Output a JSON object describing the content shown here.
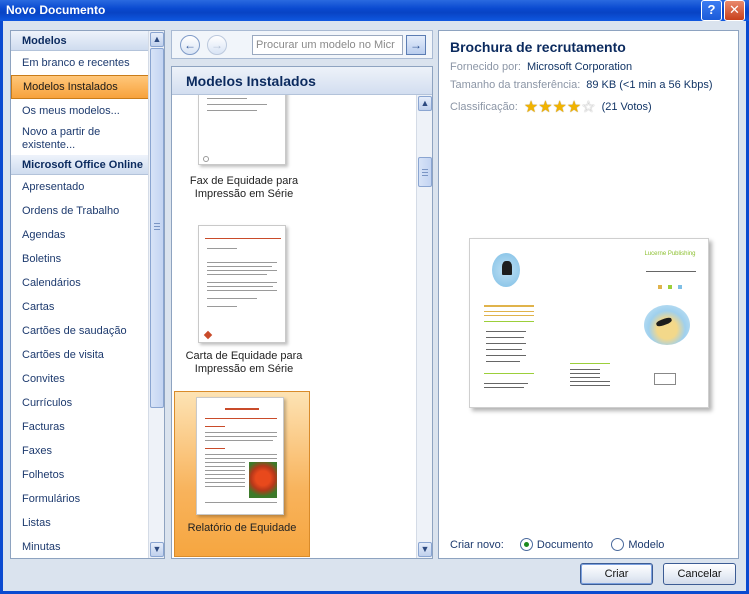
{
  "window": {
    "title": "Novo Documento",
    "help": "?",
    "close": "✕"
  },
  "left": {
    "sections": [
      {
        "header": "Modelos",
        "items": [
          {
            "label": "Em branco e recentes",
            "selected": false
          },
          {
            "label": "Modelos Instalados",
            "selected": true
          },
          {
            "label": "Os meus modelos...",
            "selected": false
          },
          {
            "label": "Novo a partir de existente...",
            "selected": false
          }
        ]
      },
      {
        "header": "Microsoft Office Online",
        "items": [
          {
            "label": "Apresentado"
          },
          {
            "label": "Ordens de Trabalho"
          },
          {
            "label": "Agendas"
          },
          {
            "label": "Boletins"
          },
          {
            "label": "Calendários"
          },
          {
            "label": "Cartas"
          },
          {
            "label": "Cartões de saudação"
          },
          {
            "label": "Cartões de visita"
          },
          {
            "label": "Convites"
          },
          {
            "label": "Currículos"
          },
          {
            "label": "Facturas"
          },
          {
            "label": "Faxes"
          },
          {
            "label": "Folhetos"
          },
          {
            "label": "Formulários"
          },
          {
            "label": "Listas"
          },
          {
            "label": "Minutas"
          }
        ]
      }
    ]
  },
  "search": {
    "placeholder": "Procurar um modelo no Micr",
    "back_icon": "←",
    "forward_icon": "→",
    "go_icon": "→"
  },
  "middle": {
    "title": "Modelos Instalados",
    "templates": [
      {
        "label": "Fax de Equidade para Impressão em Série"
      },
      {
        "label": "Carta de Equidade para Impressão em Série"
      },
      {
        "label": "Relatório de Equidade",
        "selected": true
      }
    ]
  },
  "details": {
    "title": "Brochura de recrutamento",
    "provided_label": "Fornecido por:",
    "provided_value": "Microsoft Corporation",
    "size_label": "Tamanho da transferência:",
    "size_value": "89 KB (<1 min a 56 Kbps)",
    "rating_label": "Classificação:",
    "rating": 4,
    "rating_max": 5,
    "votes": "(21 Votos)",
    "preview": {
      "brand": "Lucerne Publishing"
    },
    "create_label": "Criar novo:",
    "option_document": "Documento",
    "option_template": "Modelo",
    "selected_option": "Documento"
  },
  "buttons": {
    "create": "Criar",
    "cancel": "Cancelar"
  },
  "colors": {
    "accent": "#0b2a5e",
    "selection": "#f7a23c",
    "titlebar": "#0a4ad0"
  }
}
